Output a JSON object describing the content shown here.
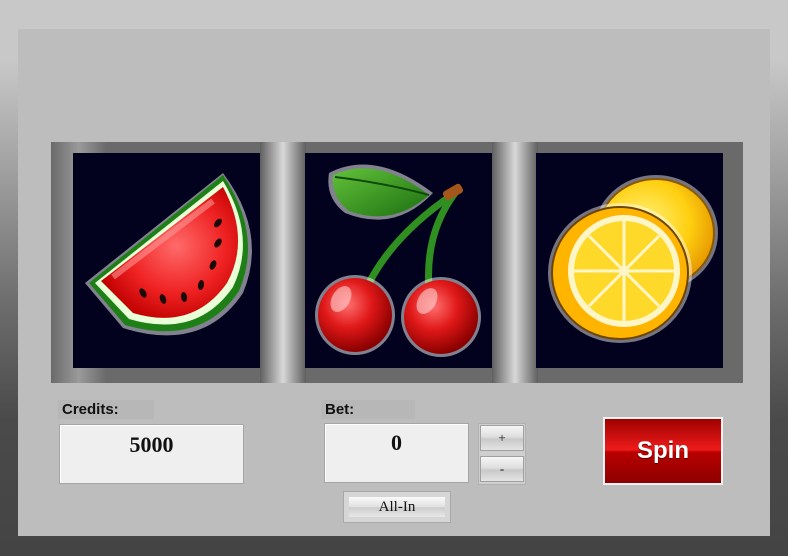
{
  "reels": [
    {
      "symbol": "watermelon-icon"
    },
    {
      "symbol": "cherries-icon"
    },
    {
      "symbol": "lemon-icon"
    }
  ],
  "credits": {
    "label": "Credits:",
    "value": "5000"
  },
  "bet": {
    "label": "Bet:",
    "value": "0",
    "plus_label": "+",
    "minus_label": "-"
  },
  "all_in_label": "All-In",
  "spin_label": "Spin",
  "colors": {
    "spin": "#d40000",
    "reel_bg": "#03021e",
    "panel": "#bdbdbd"
  }
}
